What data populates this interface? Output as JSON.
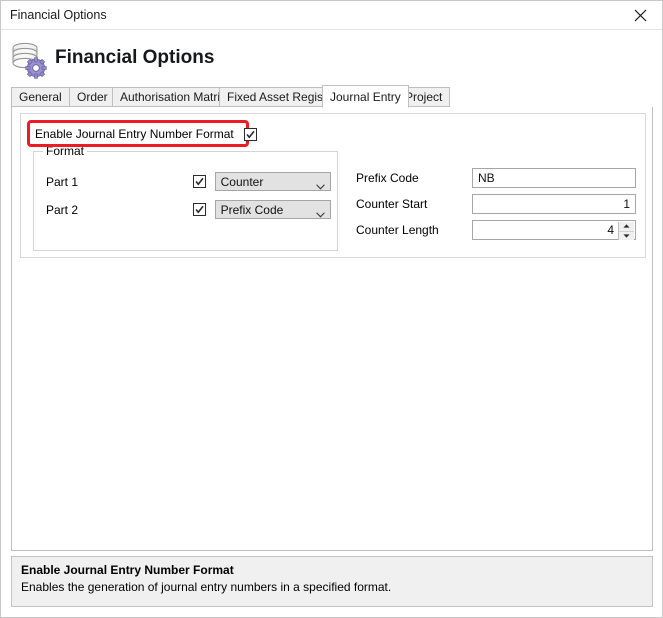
{
  "window": {
    "title": "Financial Options",
    "close_icon": "close-icon"
  },
  "header": {
    "heading": "Financial Options",
    "icon": "database-settings-icon"
  },
  "tabs": [
    {
      "label": "General",
      "active": false
    },
    {
      "label": "Order",
      "active": false
    },
    {
      "label": "Authorisation Matrix",
      "active": false
    },
    {
      "label": "Fixed Asset Register",
      "active": false
    },
    {
      "label": "Journal Entry",
      "active": true
    },
    {
      "label": "Project",
      "active": false
    }
  ],
  "form": {
    "enable": {
      "label": "Enable Journal Entry Number Format",
      "checked": true,
      "highlighted": true,
      "highlight_color": "#ed1c24"
    },
    "format_group": {
      "caption": "Format",
      "rows": [
        {
          "label": "Part 1",
          "checked": true,
          "value": "Counter",
          "options": [
            "Counter",
            "Prefix Code"
          ]
        },
        {
          "label": "Part 2",
          "checked": true,
          "value": "Prefix Code",
          "options": [
            "Counter",
            "Prefix Code"
          ]
        }
      ]
    },
    "fields": [
      {
        "label": "Prefix Code",
        "value": "NB",
        "align": "left",
        "spinner": false
      },
      {
        "label": "Counter Start",
        "value": "1",
        "align": "right",
        "spinner": false
      },
      {
        "label": "Counter Length",
        "value": "4",
        "align": "right",
        "spinner": true
      }
    ]
  },
  "help": {
    "title": "Enable Journal Entry Number Format",
    "description": "Enables the generation of journal entry numbers in a specified format."
  }
}
